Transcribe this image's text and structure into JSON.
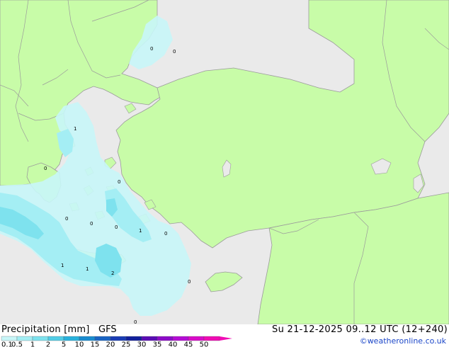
{
  "footer": {
    "title": "Precipitation [mm]",
    "product": "GFS",
    "timestamp": "Su 21-12-2025 09..12 UTC (12+240)",
    "credit": "©weatheronline.co.uk"
  },
  "legend": {
    "ticks": [
      "0.1",
      "0.5",
      "1",
      "2",
      "5",
      "10",
      "15",
      "20",
      "25",
      "30",
      "35",
      "40",
      "45",
      "50"
    ],
    "colors": [
      "#c8f6f8",
      "#a4eef4",
      "#7ee2ee",
      "#52cde6",
      "#2ab2dc",
      "#1a8cd0",
      "#1a64c4",
      "#1a3cb4",
      "#12209c",
      "#5a0cb4",
      "#8c0cc8",
      "#b40cd4",
      "#d80cc8",
      "#f00cb4"
    ]
  },
  "map": {
    "colors": {
      "land": "#c8fca8",
      "sea": "#eaeaea",
      "border": "#9b9b9b",
      "precip_light": "#c8f6f8",
      "precip_mid": "#a4eef4",
      "precip_heavy": "#7ee2ee",
      "precip_max": "#52cde6"
    },
    "labels": [
      {
        "text": "0"
      },
      {
        "text": "0"
      },
      {
        "text": "1"
      },
      {
        "text": "0"
      },
      {
        "text": "0"
      },
      {
        "text": "0"
      },
      {
        "text": "0"
      },
      {
        "text": "0"
      },
      {
        "text": "1"
      },
      {
        "text": "0"
      },
      {
        "text": "1"
      },
      {
        "text": "1"
      },
      {
        "text": "2"
      },
      {
        "text": "0"
      },
      {
        "text": "0"
      }
    ]
  }
}
